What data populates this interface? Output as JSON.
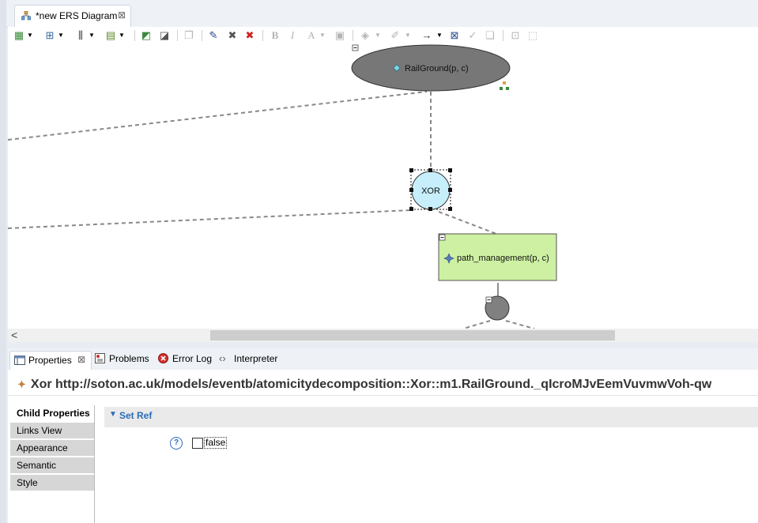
{
  "editor": {
    "tab_title": "*new ERS Diagram",
    "close_glyph": "⊠"
  },
  "toolbar": {
    "icons": [
      "layout-icon",
      "arrange-icon",
      "distribute-icon",
      "align-icon",
      "select-all-icon",
      "select-icon",
      "copy-appearance-icon",
      "pin-icon",
      "delete-icon",
      "delete-model-icon",
      "bold-icon",
      "italic-icon",
      "font-color-icon",
      "fill-font-icon",
      "fill-color-icon",
      "line-color-icon",
      "arrow-style-icon",
      "zoom-icon",
      "apply-icon",
      "copy-icon",
      "group-icon",
      "ungroup-icon"
    ],
    "bold": "B",
    "italic": "I",
    "font": "A"
  },
  "diagram": {
    "root_label": "RailGround(p, c)",
    "xor_label": "XOR",
    "child_label": "path_management(p, c)",
    "colors": {
      "root_fill": "#777777",
      "xor_fill": "#c6eefb",
      "child_fill": "#cdf0a2",
      "and_fill": "#808080",
      "connector": "#888888"
    }
  },
  "scrollbar": {
    "left_glyph": "<"
  },
  "properties_view": {
    "tabs": [
      "Properties",
      "Problems",
      "Error Log",
      "Interpreter"
    ],
    "title": "Xor http://soton.ac.uk/models/eventb/atomicitydecomposition::Xor::m1.RailGround._qIcroMJvEemVuvmwVoh-qw",
    "side_tabs": [
      "Child Properties",
      "Links View",
      "Appearance",
      "Semantic",
      "Style"
    ],
    "section_title": "Set Ref",
    "help_glyph": "?",
    "checkbox_label": "false",
    "checkbox_checked": false
  }
}
